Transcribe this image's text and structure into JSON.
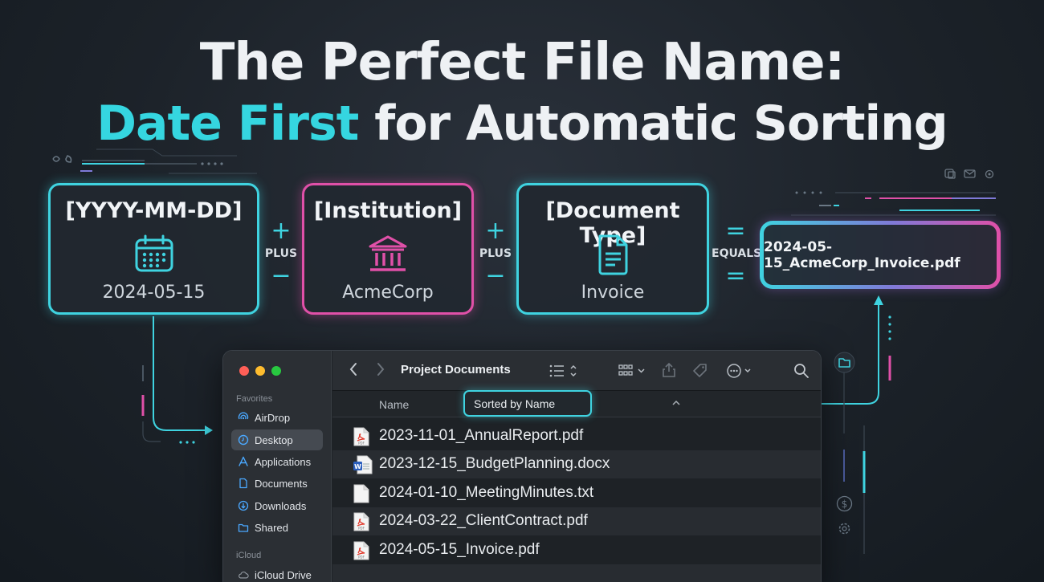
{
  "title": {
    "line1": "The Perfect File Name:",
    "line2_accent": "Date First",
    "line2_rest": " for Automatic Sorting"
  },
  "formula": {
    "boxes": [
      {
        "label": "[YYYY-MM-DD]",
        "value": "2024-05-15",
        "icon": "calendar-icon",
        "color": "#3fd3e0"
      },
      {
        "label": "[Institution]",
        "value": "AcmeCorp",
        "icon": "bank-icon",
        "color": "#e050a8"
      },
      {
        "label": "[Document Type]",
        "value": "Invoice",
        "icon": "document-icon",
        "color": "#3fd3e0"
      }
    ],
    "ops": [
      {
        "top": "+",
        "word": "PLUS",
        "bottom": "−"
      },
      {
        "top": "+",
        "word": "PLUS",
        "bottom": "−"
      },
      {
        "top": "=",
        "word": "EQUALS",
        "bottom": "="
      }
    ],
    "result": "2024-05-15_AcmeCorp_Invoice.pdf"
  },
  "finder": {
    "toolbar_title": "Project Documents",
    "sidebar": {
      "favorites_header": "Favorites",
      "items": [
        {
          "label": "AirDrop",
          "icon": "airdrop-icon"
        },
        {
          "label": "Desktop",
          "icon": "desktop-icon",
          "active": true
        },
        {
          "label": "Applications",
          "icon": "applications-icon"
        },
        {
          "label": "Documents",
          "icon": "documents-icon"
        },
        {
          "label": "Downloads",
          "icon": "downloads-icon"
        },
        {
          "label": "Shared",
          "icon": "shared-folder-icon"
        }
      ],
      "icloud_header": "iCloud",
      "icloud_items": [
        {
          "label": "iCloud Drive",
          "icon": "cloud-icon"
        }
      ]
    },
    "column_header": "Name",
    "sort_label": "Sorted by Name",
    "files": [
      {
        "name": "2023-11-01_AnnualReport.pdf",
        "type": "pdf"
      },
      {
        "name": "2023-12-15_BudgetPlanning.docx",
        "type": "docx"
      },
      {
        "name": "2024-01-10_MeetingMinutes.txt",
        "type": "txt"
      },
      {
        "name": "2024-03-22_ClientContract.pdf",
        "type": "pdf"
      },
      {
        "name": "2024-05-15_Invoice.pdf",
        "type": "pdf"
      }
    ]
  },
  "colors": {
    "accent_cyan": "#3fd3e0",
    "accent_pink": "#e050a8",
    "background": "#1c2229"
  }
}
